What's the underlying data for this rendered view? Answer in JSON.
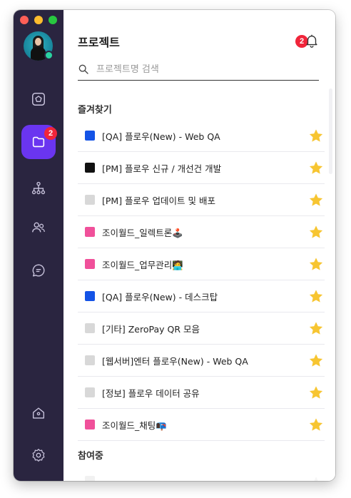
{
  "app": {
    "notifications_count": "2",
    "projects_badge": "2"
  },
  "sidebar": {
    "items": [
      {
        "name": "home-pentagon",
        "icon": "pentagon-icon"
      },
      {
        "name": "projects",
        "icon": "folder-icon",
        "active": true
      },
      {
        "name": "org-chart",
        "icon": "hierarchy-icon"
      },
      {
        "name": "people",
        "icon": "people-icon"
      },
      {
        "name": "chat",
        "icon": "chat-icon"
      }
    ],
    "bottom": [
      {
        "name": "house",
        "icon": "house-icon"
      },
      {
        "name": "settings",
        "icon": "gear-icon"
      }
    ],
    "accent": "#6a35f0",
    "background": "#2a2540"
  },
  "main": {
    "title": "프로젝트",
    "search": {
      "placeholder": "프로젝트명 검색",
      "value": ""
    },
    "favorites_title": "즐겨찾기",
    "participating_title": "참여중",
    "favorites": [
      {
        "label": "[QA] 플로우(New) - Web QA",
        "color": "#1453e6"
      },
      {
        "label": "[PM] 플로우 신규 / 개선건 개발",
        "color": "#111111"
      },
      {
        "label": "[PM] 플로우 업데이트 및 배포",
        "color": "#d8d8d8"
      },
      {
        "label": "조이월드_일렉트론🕹️",
        "color": "#f0509a"
      },
      {
        "label": "조이월드_업무관리🧑‍💻",
        "color": "#f0509a"
      },
      {
        "label": "[QA] 플로우(New) - 데스크탑",
        "color": "#1453e6"
      },
      {
        "label": "[기타] ZeroPay QR 모음",
        "color": "#d8d8d8"
      },
      {
        "label": "[웹서버]엔터 플로우(New) - Web QA",
        "color": "#d8d8d8"
      },
      {
        "label": "[정보] 플로우 데이터 공유",
        "color": "#d8d8d8"
      },
      {
        "label": "조이월드_채팅📭",
        "color": "#f0509a"
      }
    ],
    "star_color": "#f7c531"
  }
}
